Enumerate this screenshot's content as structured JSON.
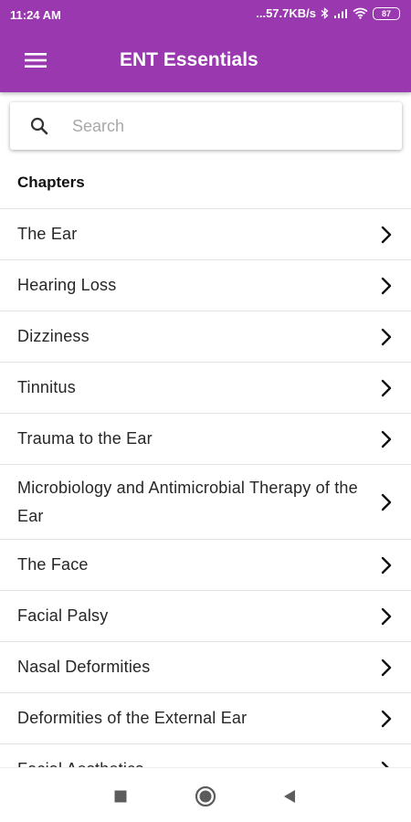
{
  "status_bar": {
    "time": "11:24 AM",
    "speed": "...57.7KB/s",
    "battery": "87"
  },
  "app_bar": {
    "title": "ENT Essentials",
    "menu_icon": "hamburger-menu-icon"
  },
  "search": {
    "placeholder": "Search",
    "value": ""
  },
  "chapters": {
    "heading": "Chapters",
    "items": [
      {
        "label": "The Ear"
      },
      {
        "label": "Hearing Loss"
      },
      {
        "label": "Dizziness"
      },
      {
        "label": "Tinnitus"
      },
      {
        "label": "Trauma to the Ear"
      },
      {
        "label": "Microbiology and Antimicrobial Therapy of the Ear"
      },
      {
        "label": "The Face"
      },
      {
        "label": "Facial Palsy"
      },
      {
        "label": "Nasal Deformities"
      },
      {
        "label": "Deformities of the External Ear"
      },
      {
        "label": "Facial Aesthetics"
      }
    ]
  },
  "nav_bar": {
    "recent_icon": "square-recent-apps-icon",
    "home_icon": "circle-home-icon",
    "back_icon": "triangle-back-icon"
  },
  "colors": {
    "primary": "#9a38b0",
    "divider": "#e2e2e2",
    "placeholder": "#a8a8a8"
  }
}
